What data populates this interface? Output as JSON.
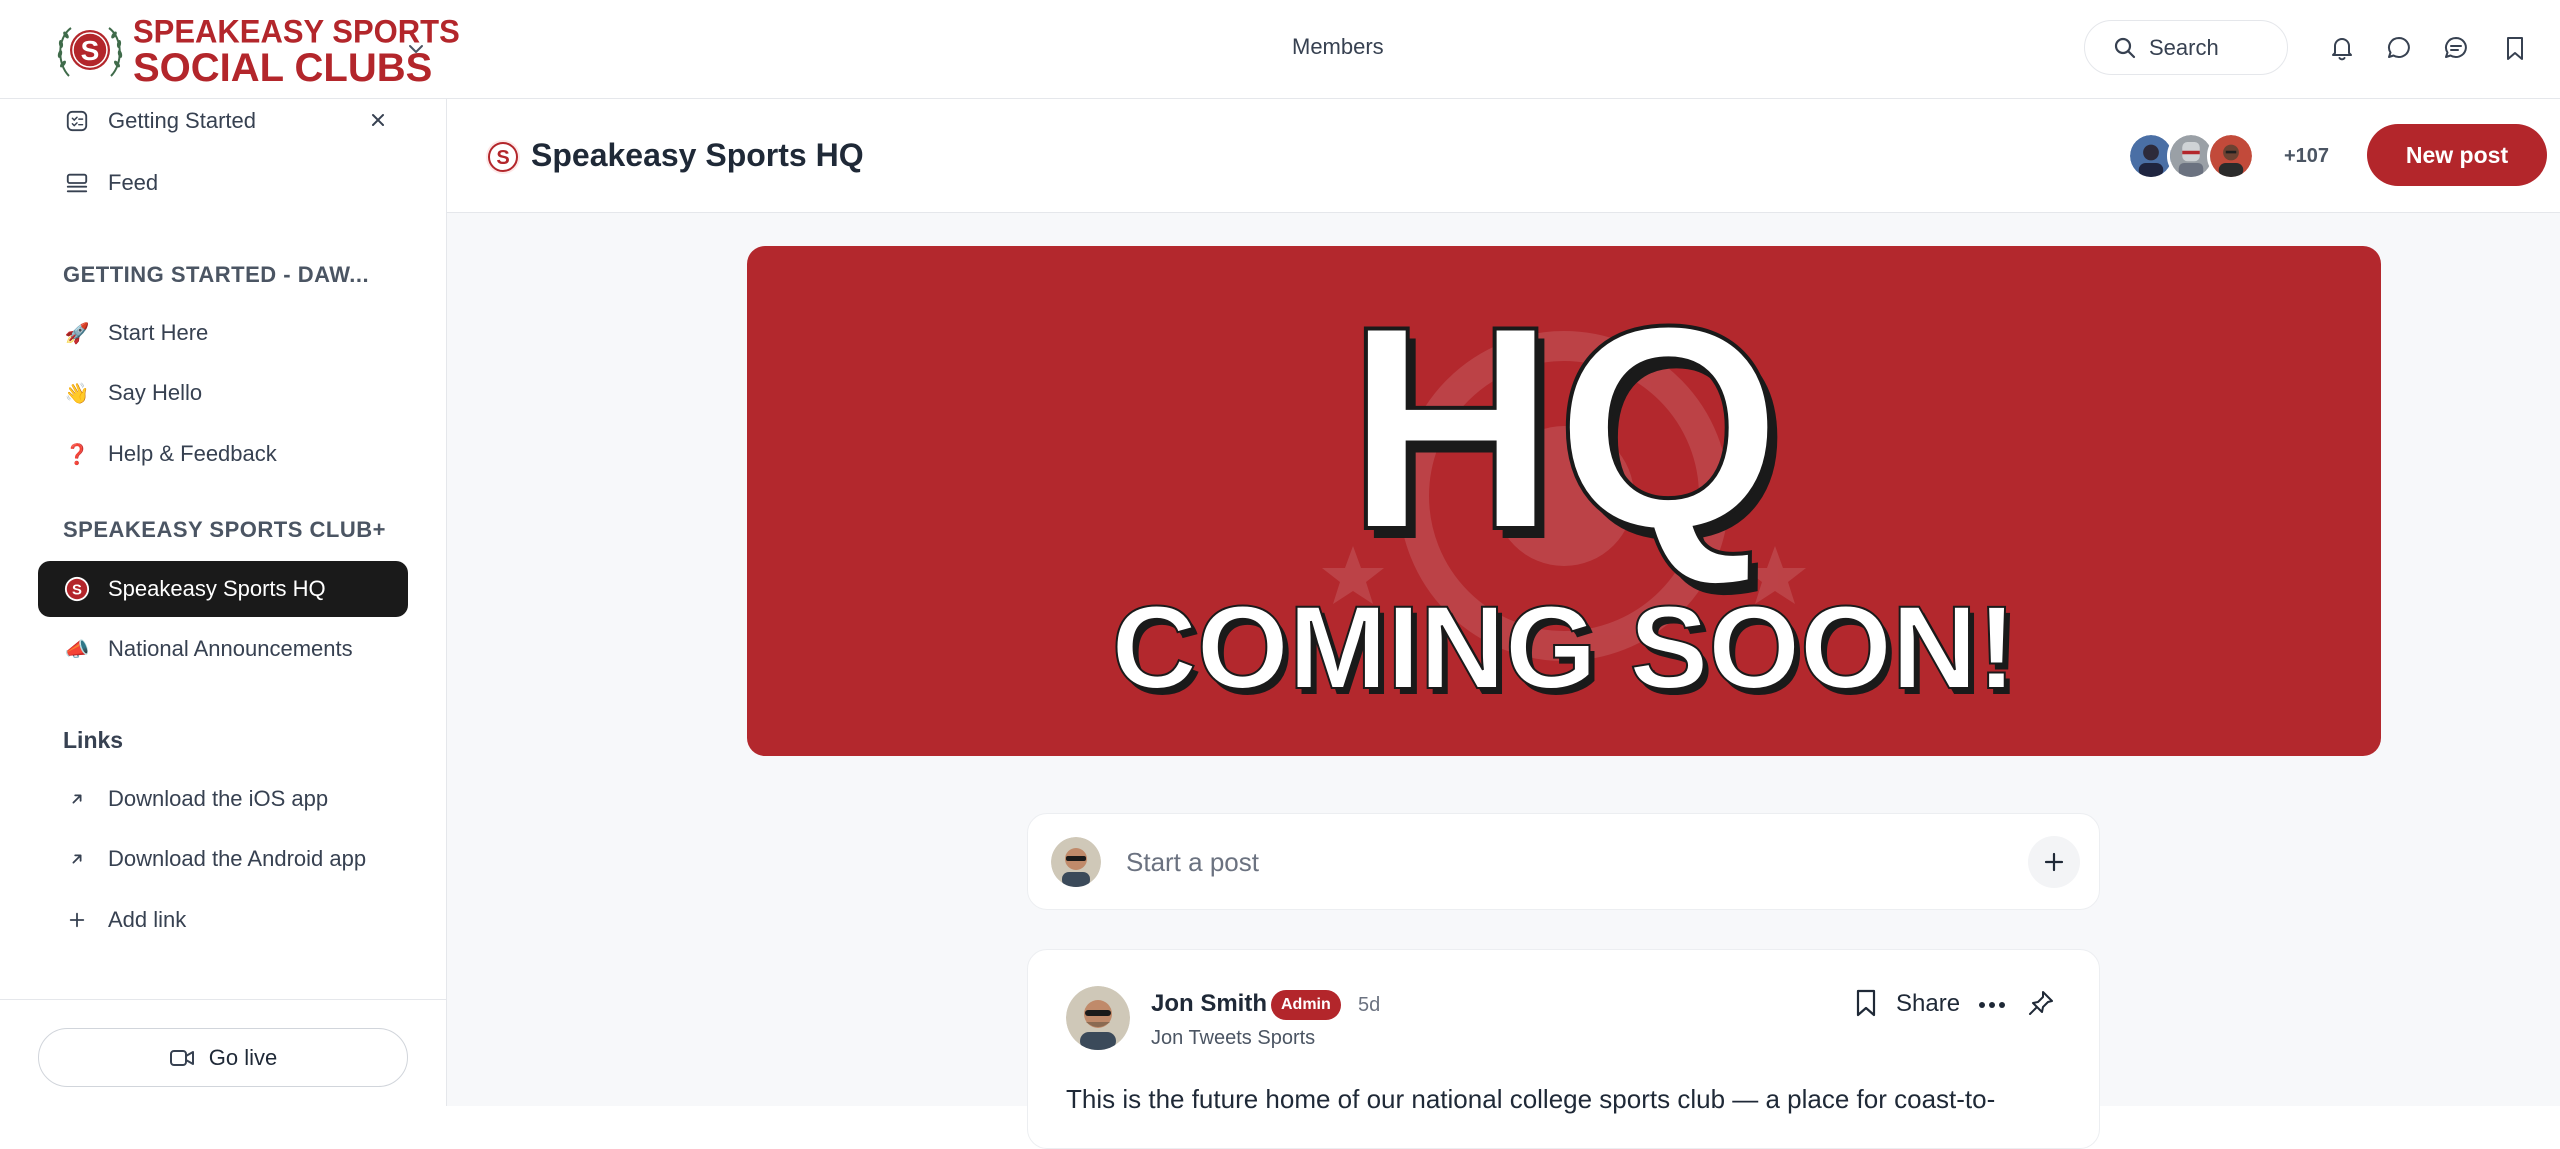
{
  "brand": {
    "line1": "SPEAKEASY SPORTS",
    "line2": "SOCIAL CLUBS",
    "monogram": "S",
    "accent_color": "#b3262b"
  },
  "topbar": {
    "members_label": "Members",
    "search_label": "Search",
    "icons": [
      "bell-icon",
      "chat-bubble-icon",
      "messages-icon",
      "bookmark-icon"
    ]
  },
  "sidebar": {
    "getting_started": "Getting Started",
    "feed": "Feed",
    "section1_heading": "GETTING STARTED - DAW...",
    "section1_items": [
      {
        "icon": "🚀",
        "label": "Start Here"
      },
      {
        "icon": "👋",
        "label": "Say Hello"
      },
      {
        "icon": "❓",
        "label": "Help & Feedback"
      }
    ],
    "section2_heading": "SPEAKEASY SPORTS CLUB+",
    "section2_items": [
      {
        "label": "Speakeasy Sports HQ"
      },
      {
        "icon": "📣",
        "label": "National Announcements"
      }
    ],
    "links_heading": "Links",
    "links": [
      {
        "label": "Download the iOS app"
      },
      {
        "label": "Download the Android app"
      },
      {
        "label": "Add link"
      }
    ],
    "go_live": "Go live"
  },
  "space": {
    "title": "Speakeasy Sports HQ",
    "member_extra": "+107",
    "new_post": "New post"
  },
  "banner": {
    "headline": "HQ",
    "subline": "COMING SOON!",
    "background": "#b3282d"
  },
  "composer": {
    "placeholder": "Start a post"
  },
  "post": {
    "author": "Jon Smith",
    "badge": "Admin",
    "time": "5d",
    "subtitle": "Jon Tweets Sports",
    "share": "Share",
    "body": "This is the future home of our national college sports club — a place for coast-to-"
  }
}
